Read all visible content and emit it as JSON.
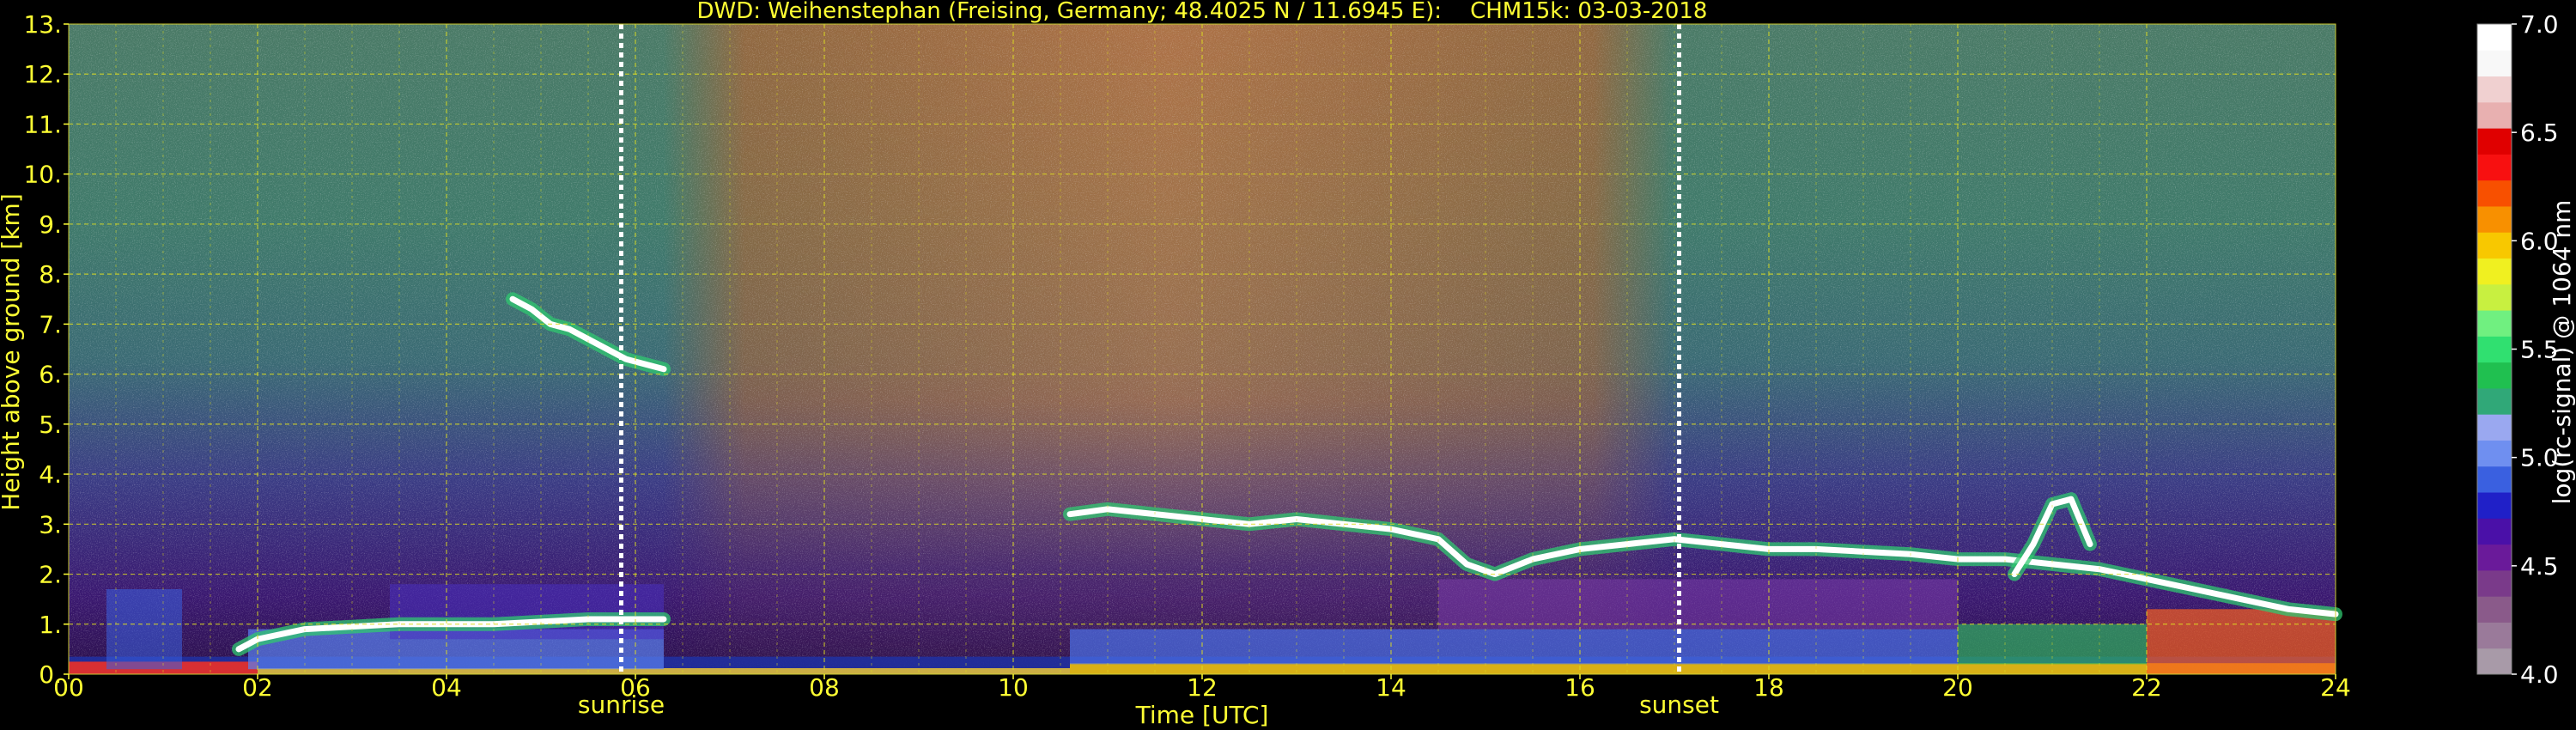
{
  "chart_data": {
    "type": "heatmap",
    "title": "DWD: Weihenstephan (Freising, Germany; 48.4025 N / 11.6945 E):    CHM15k: 03-03-2018",
    "xlabel": "Time [UTC]",
    "ylabel": "Height above ground [km]",
    "xlim": [
      0,
      24
    ],
    "ylim": [
      0,
      13
    ],
    "x_ticks": [
      {
        "value": 0,
        "label": "00"
      },
      {
        "value": 2,
        "label": "02"
      },
      {
        "value": 4,
        "label": "04"
      },
      {
        "value": 6,
        "label": "06"
      },
      {
        "value": 8,
        "label": "08"
      },
      {
        "value": 10,
        "label": "10"
      },
      {
        "value": 12,
        "label": "12"
      },
      {
        "value": 14,
        "label": "14"
      },
      {
        "value": 16,
        "label": "16"
      },
      {
        "value": 18,
        "label": "18"
      },
      {
        "value": 20,
        "label": "20"
      },
      {
        "value": 22,
        "label": "22"
      },
      {
        "value": 24,
        "label": "24"
      }
    ],
    "y_ticks": [
      {
        "value": 0,
        "label": "0."
      },
      {
        "value": 1,
        "label": "1."
      },
      {
        "value": 2,
        "label": "2."
      },
      {
        "value": 3,
        "label": "3."
      },
      {
        "value": 4,
        "label": "4."
      },
      {
        "value": 5,
        "label": "5."
      },
      {
        "value": 6,
        "label": "6."
      },
      {
        "value": 7,
        "label": "7."
      },
      {
        "value": 8,
        "label": "8."
      },
      {
        "value": 9,
        "label": "9."
      },
      {
        "value": 10,
        "label": "10."
      },
      {
        "value": 11,
        "label": "11."
      },
      {
        "value": 12,
        "label": "12."
      },
      {
        "value": 13,
        "label": "13."
      }
    ],
    "grid": true,
    "markers": [
      {
        "label": "sunrise",
        "x": 5.85
      },
      {
        "label": "sunset",
        "x": 17.05
      }
    ],
    "colorbar": {
      "label": "log(rc-signal) @ 1064 nm",
      "range": [
        4.0,
        7.0
      ],
      "ticks": [
        {
          "value": 4.0,
          "label": "4.0"
        },
        {
          "value": 4.5,
          "label": "4.5"
        },
        {
          "value": 5.0,
          "label": "5.0"
        },
        {
          "value": 5.5,
          "label": "5.5"
        },
        {
          "value": 6.0,
          "label": "6.0"
        },
        {
          "value": 6.5,
          "label": "6.5"
        },
        {
          "value": 7.0,
          "label": "7.0"
        }
      ],
      "colors": [
        "#a89aa8",
        "#9a7a9a",
        "#8a5a8a",
        "#7a3a8a",
        "#6a1a9a",
        "#4a10a8",
        "#2020c8",
        "#3a60e0",
        "#6f8ff0",
        "#9aa8f0",
        "#30a878",
        "#20c050",
        "#30e070",
        "#70f080",
        "#c8f040",
        "#f0f020",
        "#f8c800",
        "#f89000",
        "#f85000",
        "#f81010",
        "#e00000",
        "#e8b0b0",
        "#f0d0d0",
        "#f8f8f8",
        "#ffffff"
      ]
    },
    "features": [
      {
        "name": "cloud",
        "x": [
          10.6,
          11.0,
          11.5,
          12.0,
          12.5,
          13.0,
          13.5,
          14.0,
          14.5,
          14.8,
          15.1,
          15.5,
          16.0,
          16.5,
          17.0,
          17.5,
          18.0,
          18.5,
          19.0,
          19.5,
          20.0,
          20.5,
          21.0,
          21.5,
          22.0,
          22.5,
          23.0,
          23.5,
          24.0
        ],
        "y": [
          3.2,
          3.3,
          3.2,
          3.1,
          3.0,
          3.1,
          3.0,
          2.9,
          2.7,
          2.2,
          2.0,
          2.3,
          2.5,
          2.6,
          2.7,
          2.6,
          2.5,
          2.5,
          2.45,
          2.4,
          2.3,
          2.3,
          2.2,
          2.1,
          1.9,
          1.7,
          1.5,
          1.3,
          1.2
        ]
      },
      {
        "name": "cloud",
        "x": [
          4.7,
          4.9,
          5.1,
          5.3,
          5.5,
          5.7,
          5.9,
          6.1,
          6.3
        ],
        "y": [
          7.5,
          7.3,
          7.0,
          6.9,
          6.7,
          6.5,
          6.3,
          6.2,
          6.1
        ]
      },
      {
        "name": "cloud",
        "x": [
          1.8,
          2.0,
          2.5,
          3.0,
          3.5,
          4.0,
          4.5,
          5.0,
          5.5,
          6.0,
          6.3
        ],
        "y": [
          0.5,
          0.7,
          0.9,
          0.95,
          1.0,
          1.0,
          1.0,
          1.05,
          1.1,
          1.1,
          1.1
        ]
      },
      {
        "name": "cloud",
        "x": [
          20.6,
          20.8,
          21.0,
          21.2,
          21.4
        ],
        "y": [
          2.0,
          2.6,
          3.4,
          3.5,
          2.6
        ]
      }
    ]
  }
}
